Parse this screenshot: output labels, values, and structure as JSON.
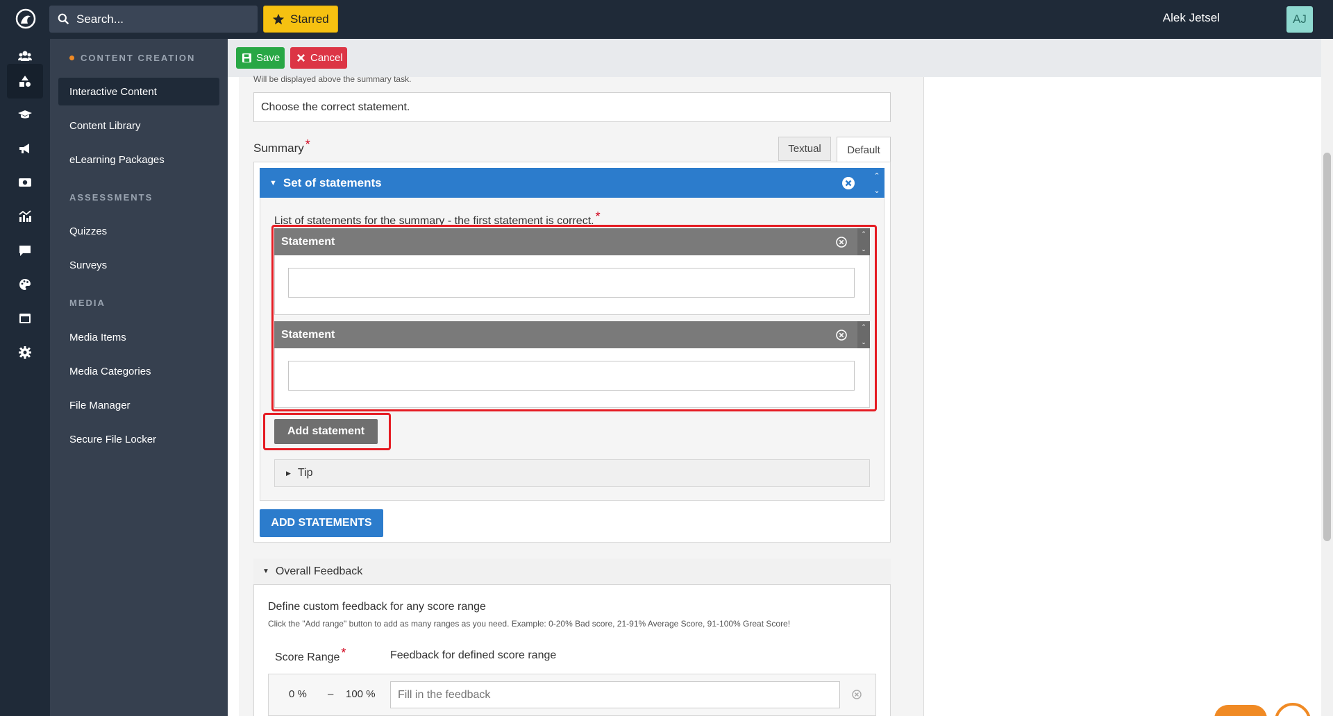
{
  "topbar": {
    "search_placeholder": "Search...",
    "starred_label": "Starred",
    "user_name": "Alek Jetsel",
    "avatar_initials": "AJ"
  },
  "rail": {
    "icons": [
      "users-icon",
      "shapes-icon",
      "graduation-cap-icon",
      "megaphone-icon",
      "media-icon",
      "analytics-icon",
      "chat-icon",
      "palette-icon",
      "window-icon",
      "gear-icon"
    ],
    "active_index": 1
  },
  "sidebar": {
    "sections": [
      {
        "title": "CONTENT CREATION",
        "items": [
          "Interactive Content",
          "Content Library",
          "eLearning Packages"
        ]
      },
      {
        "title": "ASSESSMENTS",
        "items": [
          "Quizzes",
          "Surveys"
        ]
      },
      {
        "title": "MEDIA",
        "items": [
          "Media Items",
          "Media Categories",
          "File Manager",
          "Secure File Locker"
        ]
      }
    ],
    "active_item": "Interactive Content"
  },
  "toolbar": {
    "save_label": "Save",
    "cancel_label": "Cancel"
  },
  "editor": {
    "help_text": "Will be displayed above the summary task.",
    "intro_value": "Choose the correct statement.",
    "summary_label": "Summary",
    "required_mark": "*",
    "tabs": [
      "Textual",
      "Default"
    ],
    "active_tab": "Default",
    "set_title": "Set of statements",
    "list_label": "List of statements for the summary - the first statement is correct.",
    "statements": [
      {
        "title": "Statement",
        "value": ""
      },
      {
        "title": "Statement",
        "value": ""
      }
    ],
    "add_statement_label": "Add statement",
    "tip_label": "Tip",
    "add_statements_label": "ADD STATEMENTS",
    "overall_feedback": {
      "title": "Overall Feedback",
      "subtitle": "Define custom feedback for any score range",
      "description": "Click the \"Add range\" button to add as many ranges as you need. Example: 0-20% Bad score, 21-91% Average Score, 91-100% Great Score!",
      "score_range_label": "Score Range",
      "feedback_label": "Feedback for defined score range",
      "range_min": "0 %",
      "range_separator": "–",
      "range_max": "100 %",
      "feedback_placeholder": "Fill in the feedback"
    }
  },
  "colors": {
    "topbar_bg": "#1f2a38",
    "sidebar_bg": "#36404f",
    "accent_blue": "#2c7ccc",
    "highlight_red": "#e51c23",
    "starred_yellow": "#f6c111",
    "save_green": "#28a745",
    "cancel_red": "#dc3545"
  }
}
